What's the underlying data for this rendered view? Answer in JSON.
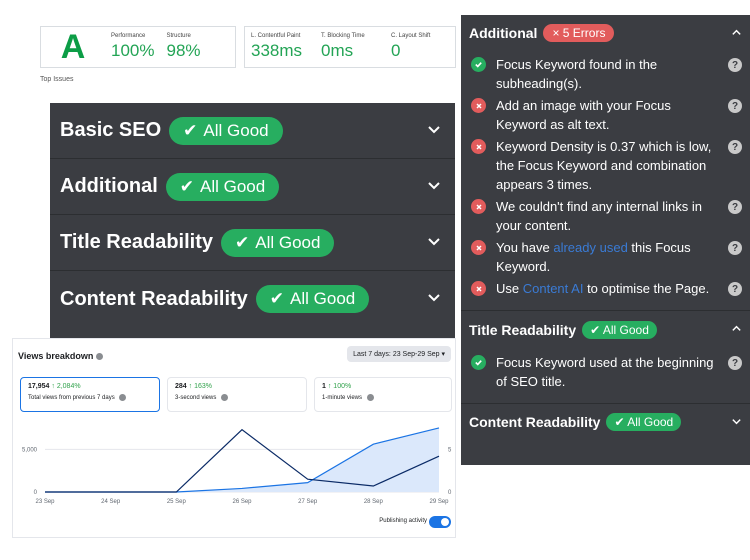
{
  "gtmetrix": {
    "grade": "A",
    "performance_label": "Performance",
    "performance_value": "100%",
    "structure_label": "Structure",
    "structure_value": "98%",
    "lcp_label": "L. Contentful Paint",
    "lcp_value": "338ms",
    "tbt_label": "T. Blocking Time",
    "tbt_value": "0ms",
    "cls_label": "C. Layout Shift",
    "cls_value": "0",
    "top_issues": "Top Issues"
  },
  "seo_big": {
    "rows": [
      {
        "title": "Basic SEO",
        "badge": "All Good"
      },
      {
        "title": "Additional",
        "badge": "All Good"
      },
      {
        "title": "Title Readability",
        "badge": "All Good"
      },
      {
        "title": "Content Readability",
        "badge": "All Good"
      }
    ]
  },
  "seo_right": {
    "additional": {
      "title": "Additional",
      "badge": "5 Errors",
      "items": [
        {
          "status": "ok",
          "text": "Focus Keyword found in the subheading(s)."
        },
        {
          "status": "err",
          "text": "Add an image with your Focus Keyword as alt text."
        },
        {
          "status": "err",
          "text": "Keyword Density is 0.37 which is low, the Focus Keyword and combination appears 3 times."
        },
        {
          "status": "err",
          "text": "We couldn't find any internal links in your content."
        },
        {
          "status": "err",
          "pre": "You have ",
          "link": "already used",
          "post": " this Focus Keyword."
        },
        {
          "status": "err",
          "pre": "Use ",
          "link": "Content AI",
          "post": " to optimise the Page."
        }
      ]
    },
    "title_readability": {
      "title": "Title Readability",
      "badge": "All Good",
      "items": [
        {
          "status": "ok",
          "text": "Focus Keyword used at the beginning of SEO title."
        }
      ]
    },
    "content_readability": {
      "title": "Content Readability",
      "badge": "All Good"
    }
  },
  "views": {
    "title": "Views breakdown",
    "range": "Last 7 days: 23 Sep-29 Sep",
    "stats": [
      {
        "value": "17,954",
        "delta": "↑ 2,084%",
        "label": "Total views from previous 7 days"
      },
      {
        "value": "284",
        "delta": "↑ 163%",
        "label": "3-second views"
      },
      {
        "value": "1",
        "delta": "↑ 100%",
        "label": "1-minute views"
      }
    ],
    "publishing_label": "Publishing activity"
  },
  "chart_data": {
    "type": "line",
    "categories": [
      "23 Sep",
      "24 Sep",
      "25 Sep",
      "26 Sep",
      "27 Sep",
      "28 Sep",
      "29 Sep"
    ],
    "y_left_ticks": [
      "0",
      "5,000"
    ],
    "y_right_ticks": [
      "0",
      "5"
    ],
    "series": [
      {
        "values": [
          0,
          0,
          0,
          7300,
          1500,
          700,
          4200
        ],
        "axis": "left",
        "color": "#0a2a66"
      },
      {
        "values": [
          0,
          0,
          0,
          420,
          1100,
          5600,
          7500
        ],
        "axis": "left",
        "color": "#1b74e4",
        "fill": "#dbe8fb"
      }
    ],
    "ylim_left": [
      0,
      8200
    ]
  },
  "colors": {
    "panel": "#3b3d42",
    "good": "#27ae60",
    "error": "#e25c5c",
    "link": "#3a7bd5",
    "grade": "#0c9d46"
  }
}
